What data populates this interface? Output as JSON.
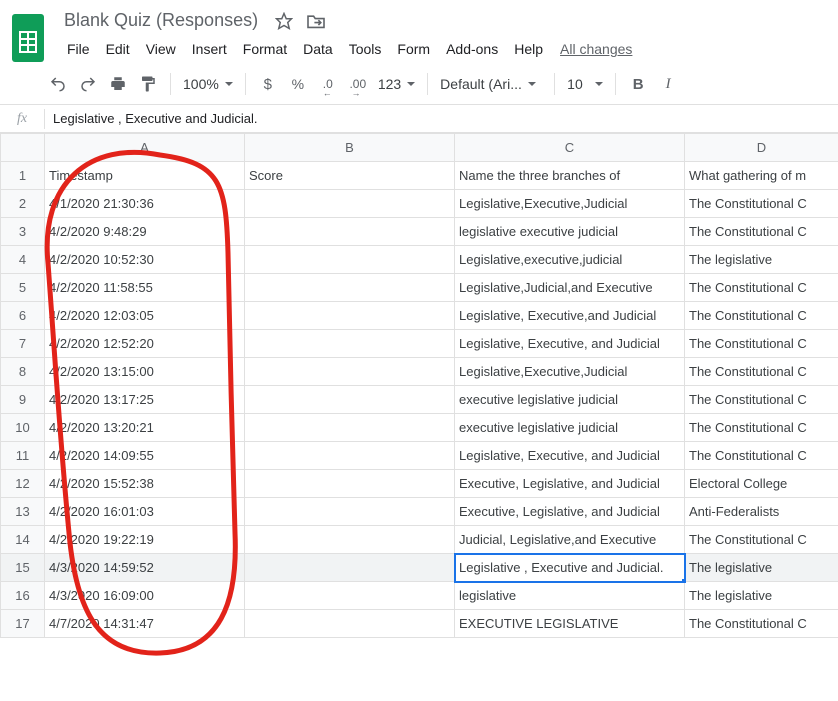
{
  "doc": {
    "title": "Blank Quiz (Responses)",
    "all_changes": "All changes"
  },
  "menubar": [
    "File",
    "Edit",
    "View",
    "Insert",
    "Format",
    "Data",
    "Tools",
    "Form",
    "Add-ons",
    "Help"
  ],
  "toolbar": {
    "zoom": "100%",
    "currency": "$",
    "percent": "%",
    "dec_dec": ".0",
    "dec_inc": ".00",
    "num_format": "123",
    "font": "Default (Ari...",
    "font_size": "10",
    "bold": "B",
    "italic": "I"
  },
  "formula": {
    "fx": "fx",
    "value": "Legislative , Executive and Judicial."
  },
  "columns": [
    "A",
    "B",
    "C",
    "D"
  ],
  "headers": {
    "a": "Timestamp",
    "b": "Score",
    "c": "Name the three branches of",
    "d": "What gathering of m"
  },
  "rows": [
    {
      "n": "1"
    },
    {
      "n": "2",
      "a": "4/1/2020 21:30:36",
      "b": "",
      "c": "Legislative,Executive,Judicial",
      "d": "The Constitutional C"
    },
    {
      "n": "3",
      "a": "4/2/2020 9:48:29",
      "b": "",
      "c": "legislative executive judicial",
      "d": "The Constitutional C"
    },
    {
      "n": "4",
      "a": "4/2/2020 10:52:30",
      "b": "",
      "c": "Legislative,executive,judicial",
      "d": "The legislative"
    },
    {
      "n": "5",
      "a": "4/2/2020 11:58:55",
      "b": "",
      "c": "Legislative,Judicial,and Executive",
      "d": "The Constitutional C"
    },
    {
      "n": "6",
      "a": "4/2/2020 12:03:05",
      "b": "",
      "c": "Legislative, Executive,and  Judicial",
      "d": "The Constitutional C"
    },
    {
      "n": "7",
      "a": "4/2/2020 12:52:20",
      "b": "",
      "c": "Legislative, Executive, and Judicial",
      "d": "The Constitutional C"
    },
    {
      "n": "8",
      "a": "4/2/2020 13:15:00",
      "b": "",
      "c": "Legislative,Executive,Judicial",
      "d": "The Constitutional C"
    },
    {
      "n": "9",
      "a": "4/2/2020 13:17:25",
      "b": "",
      "c": "executive legislative judicial",
      "d": "The Constitutional C"
    },
    {
      "n": "10",
      "a": "4/2/2020 13:20:21",
      "b": "",
      "c": "executive legislative judicial",
      "d": "The Constitutional C"
    },
    {
      "n": "11",
      "a": "4/2/2020 14:09:55",
      "b": "",
      "c": "Legislative, Executive,  and Judicial",
      "d": "The Constitutional C"
    },
    {
      "n": "12",
      "a": "4/2/2020 15:52:38",
      "b": "",
      "c": "Executive, Legislative, and Judicial",
      "d": "Electoral College"
    },
    {
      "n": "13",
      "a": "4/2/2020 16:01:03",
      "b": "",
      "c": "Executive, Legislative, and Judicial",
      "d": "Anti-Federalists"
    },
    {
      "n": "14",
      "a": "4/2/2020 19:22:19",
      "b": "",
      "c": "Judicial, Legislative,and Executive",
      "d": "The Constitutional C"
    },
    {
      "n": "15",
      "a": "4/3/2020 14:59:52",
      "b": "",
      "c": "Legislative , Executive and Judicial.",
      "d": "The legislative",
      "selected": true
    },
    {
      "n": "16",
      "a": "4/3/2020 16:09:00",
      "b": "",
      "c": "legislative",
      "d": "The legislative"
    },
    {
      "n": "17",
      "a": "4/7/2020 14:31:47",
      "b": "",
      "c": "EXECUTIVE LEGISLATIVE",
      "d": "The Constitutional C"
    }
  ],
  "icons": {
    "star": "star-icon",
    "move": "move-icon",
    "undo": "undo-icon",
    "redo": "redo-icon",
    "print": "print-icon",
    "paint": "paint-format-icon"
  },
  "colors": {
    "accent": "#1a73e8",
    "sheets_green": "#0f9d58",
    "annotation": "#e2231a"
  }
}
